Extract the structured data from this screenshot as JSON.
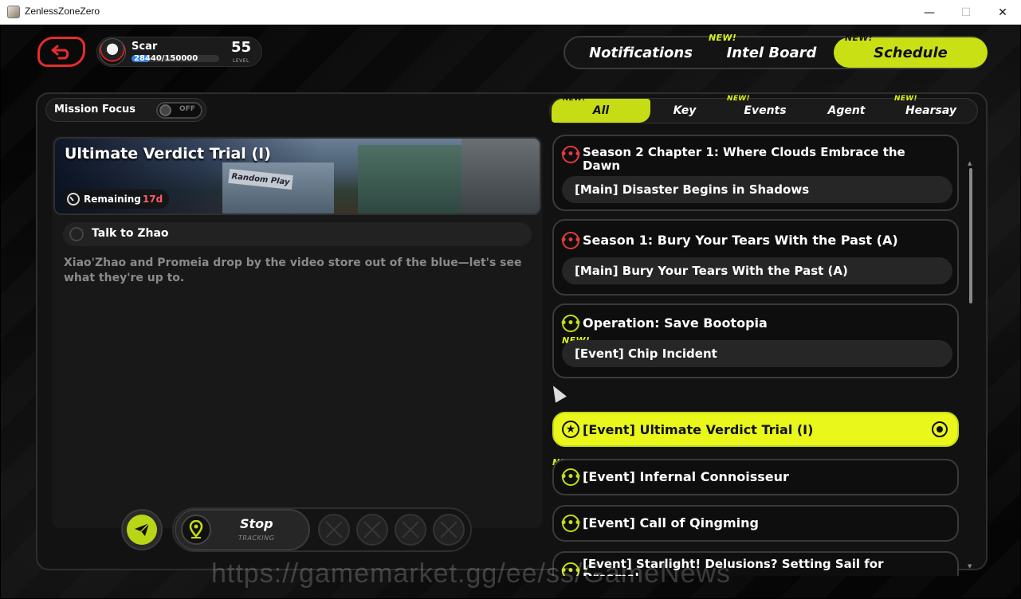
{
  "window": {
    "title": "ZenlessZoneZero",
    "minimize": "—",
    "maximize": "☐",
    "close": "✕"
  },
  "player": {
    "name": "Scar",
    "exp_current": "28440",
    "exp_total": "/150000",
    "exp_fraction": 0.19,
    "level": "55",
    "level_label": "LEVEL"
  },
  "top_tabs": {
    "notifications": "Notifications",
    "intel_board": "Intel Board",
    "schedule": "Schedule",
    "new_badge": "NEW!"
  },
  "mission_focus": {
    "label": "Mission Focus",
    "toggle_state": "OFF"
  },
  "detail": {
    "title": "Ultimate Verdict Trial (I)",
    "remaining_label": "Remaining",
    "remaining_value": "17d",
    "banner_sign": "Random Play",
    "objective": "Talk to Zhao",
    "description": "Xiao'Zhao and Promeia drop by the video store out of the blue—let's see what they're up to."
  },
  "controls": {
    "stop_label": "Stop",
    "tracking_label": "TRACKING"
  },
  "filter_tabs": {
    "all": "All",
    "key": "Key",
    "events": "Events",
    "agent": "Agent",
    "hearsay": "Hearsay",
    "new_badge": "NEW!"
  },
  "quests": {
    "q1": {
      "title": "Season 2 Chapter 1: Where Clouds Embrace the Dawn",
      "sub": "[Main] Disaster Begins in Shadows",
      "icon": "•••"
    },
    "q2": {
      "title": "Season 1: Bury Your Tears With the Past (A)",
      "sub": "[Main] Bury Your Tears With the Past (A)",
      "icon": "•••"
    },
    "q3": {
      "title": "Operation: Save Bootopia",
      "sub": "[Event] Chip Incident",
      "new": "NEW!",
      "icon": "•••"
    },
    "q4": {
      "title": "[Event] Ultimate Verdict Trial (I)",
      "icon": "★"
    },
    "q5": {
      "title": "[Event] Infernal Connoisseur",
      "new": "NEW!",
      "icon": "•••"
    },
    "q6": {
      "title": "[Event] Call of Qingming",
      "icon": "•••"
    },
    "q7": {
      "title": "[Event] Starlight! Delusions? Setting Sail for Dreams!",
      "icon": "•••"
    }
  },
  "scroll": {
    "up": "▲",
    "down": "▼"
  },
  "watermark": "https://gamemarket.gg/ee/ss/GameNews",
  "colors": {
    "accent": "#c6dd15",
    "active_card": "#e9f71b",
    "alert_red": "#e23a3a",
    "exp_blue": "#2d7de0"
  }
}
